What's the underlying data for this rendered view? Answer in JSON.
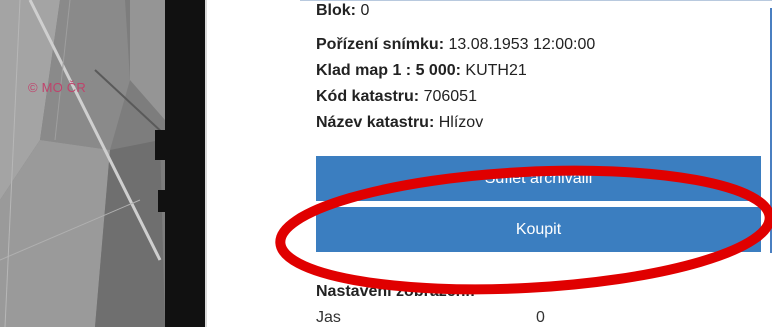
{
  "map": {
    "watermark": "© MO ČR"
  },
  "info": {
    "blok_label": "Blok:",
    "blok_value": "0",
    "porizeni_label": "Pořízení snímku:",
    "porizeni_value": "13.08.1953 12:00:00",
    "klad_label": "Klad map 1 : 5 000:",
    "klad_value": "KUTH21",
    "kod_label": "Kód katastru:",
    "kod_value": "706051",
    "nazev_label": "Název katastru:",
    "nazev_value": "Hlízov"
  },
  "buttons": {
    "share_label": "Sdílet archiválii",
    "buy_label": "Koupit"
  },
  "display": {
    "section_title": "Nastavení zobrazení:",
    "jas_label": "Jas",
    "jas_value": "0"
  },
  "colors": {
    "button": "#3b7ec0",
    "highlight": "#e00000",
    "watermark": "#c0436c"
  }
}
